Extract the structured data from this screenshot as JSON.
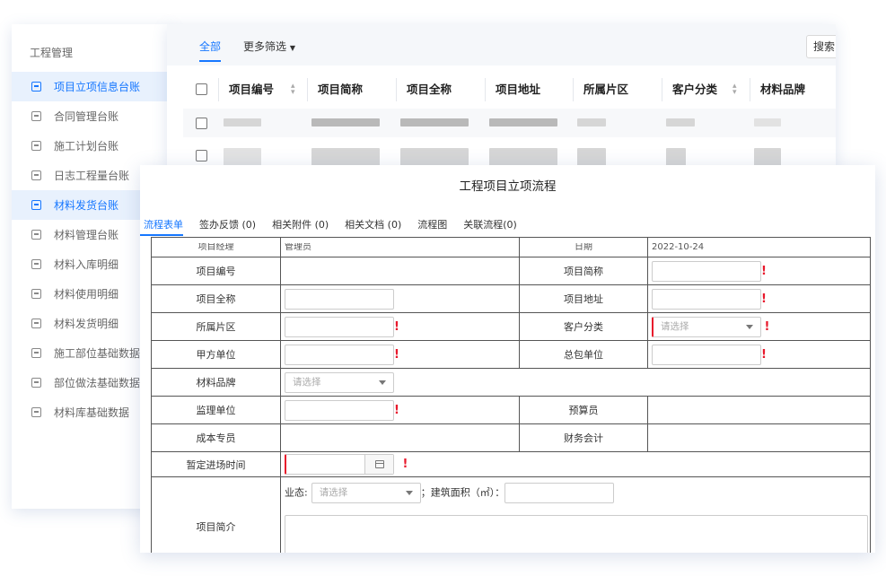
{
  "sidebar": {
    "title": "工程管理",
    "items": [
      {
        "label": "项目立项信息台账",
        "active": true
      },
      {
        "label": "合同管理台账",
        "active": false
      },
      {
        "label": "施工计划台账",
        "active": false
      },
      {
        "label": "日志工程量台账",
        "active": false
      },
      {
        "label": "材料发货台账",
        "active": true
      },
      {
        "label": "材料管理台账",
        "active": false
      },
      {
        "label": "材料入库明细",
        "active": false
      },
      {
        "label": "材料使用明细",
        "active": false
      },
      {
        "label": "材料发货明细",
        "active": false
      },
      {
        "label": "施工部位基础数据",
        "active": false
      },
      {
        "label": "部位做法基础数据",
        "active": false
      },
      {
        "label": "材料库基础数据",
        "active": false
      }
    ]
  },
  "list": {
    "tab_all": "全部",
    "tab_more": "更多筛选",
    "search_label": "搜索",
    "columns": [
      "项目编号",
      "项目简称",
      "项目全称",
      "项目地址",
      "所属片区",
      "客户分类",
      "材料品牌"
    ]
  },
  "dialog": {
    "title": "工程项目立项流程",
    "tabs": [
      "流程表单",
      "签办反馈 (0)",
      "相关附件 (0)",
      "相关文档 (0)",
      "流程图",
      "关联流程(0)"
    ],
    "form": {
      "clipped_row": {
        "label_left": "项目经理",
        "value_left": "管理员",
        "label_right": "日期",
        "value_right": "2022-10-24"
      },
      "project_no": "项目编号",
      "project_short": "项目简称",
      "project_full": "项目全称",
      "project_address": "项目地址",
      "region": "所属片区",
      "customer_type": "客户分类",
      "party_a": "甲方单位",
      "general_contractor": "总包单位",
      "material_brand": "材料品牌",
      "supervisor": "监理单位",
      "budgeter": "预算员",
      "cost_specialist": "成本专员",
      "finance": "财务会计",
      "entry_time": "暂定进场时间",
      "intro": "项目简介",
      "business_label": "业态:",
      "area_label": "；建筑面积（㎡）：",
      "select_placeholder": "请选择"
    }
  }
}
